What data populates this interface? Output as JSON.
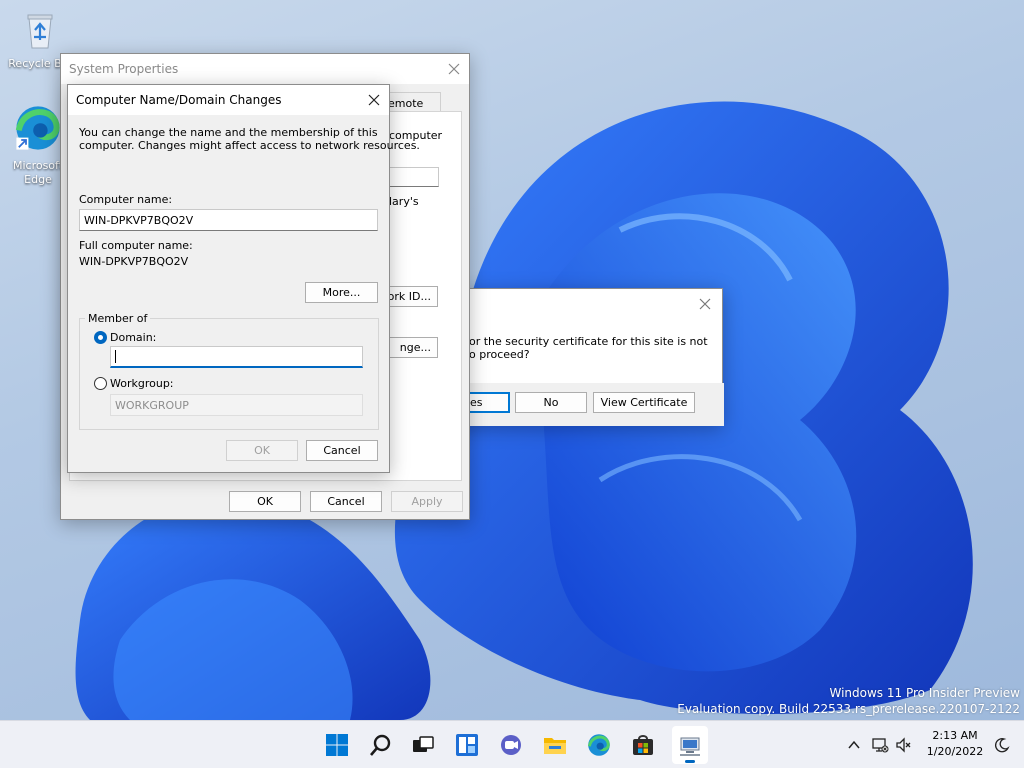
{
  "desktop": {
    "icons": [
      {
        "label": "Recycle Bin"
      },
      {
        "label": "Microsoft Edge"
      }
    ],
    "watermark": {
      "line1": "Windows 11 Pro Insider Preview",
      "line2": "Evaluation copy. Build 22533.rs_prerelease.220107-2122"
    }
  },
  "system_properties": {
    "title": "System Properties",
    "tab_partial": "emote",
    "frag_computer": "computer",
    "frag_lary": "lary's",
    "frag_network_btn": "ork ID...",
    "frag_change_btn": "nge...",
    "ok": "OK",
    "cancel": "Cancel",
    "apply": "Apply"
  },
  "security_alert": {
    "line1": "or the security certificate for this site is not",
    "line2": "o proceed?",
    "yes": "es",
    "no": "No",
    "view_certificate": "View Certificate"
  },
  "name_changes": {
    "title": "Computer Name/Domain Changes",
    "description_line1": "You can change the name and the membership of this",
    "description_line2": "computer. Changes might affect access to network resources.",
    "computer_name_label": "Computer name:",
    "computer_name_value": "WIN-DPKVP7BQO2V",
    "full_name_label": "Full computer name:",
    "full_name_value": "WIN-DPKVP7BQO2V",
    "more_button": "More...",
    "member_of": "Member of",
    "domain_label": "Domain:",
    "domain_value": "",
    "workgroup_label": "Workgroup:",
    "workgroup_value": "WORKGROUP",
    "ok": "OK",
    "cancel": "Cancel"
  },
  "taskbar": {
    "time": "2:13 AM",
    "date": "1/20/2022",
    "icons": [
      "start-icon",
      "search-icon",
      "task-view-icon",
      "widgets-icon",
      "chat-icon",
      "file-explorer-icon",
      "edge-icon",
      "store-icon",
      "system-properties-icon"
    ]
  },
  "colors": {
    "accent": "#0067c0",
    "bloom": "#1a4fd8"
  }
}
